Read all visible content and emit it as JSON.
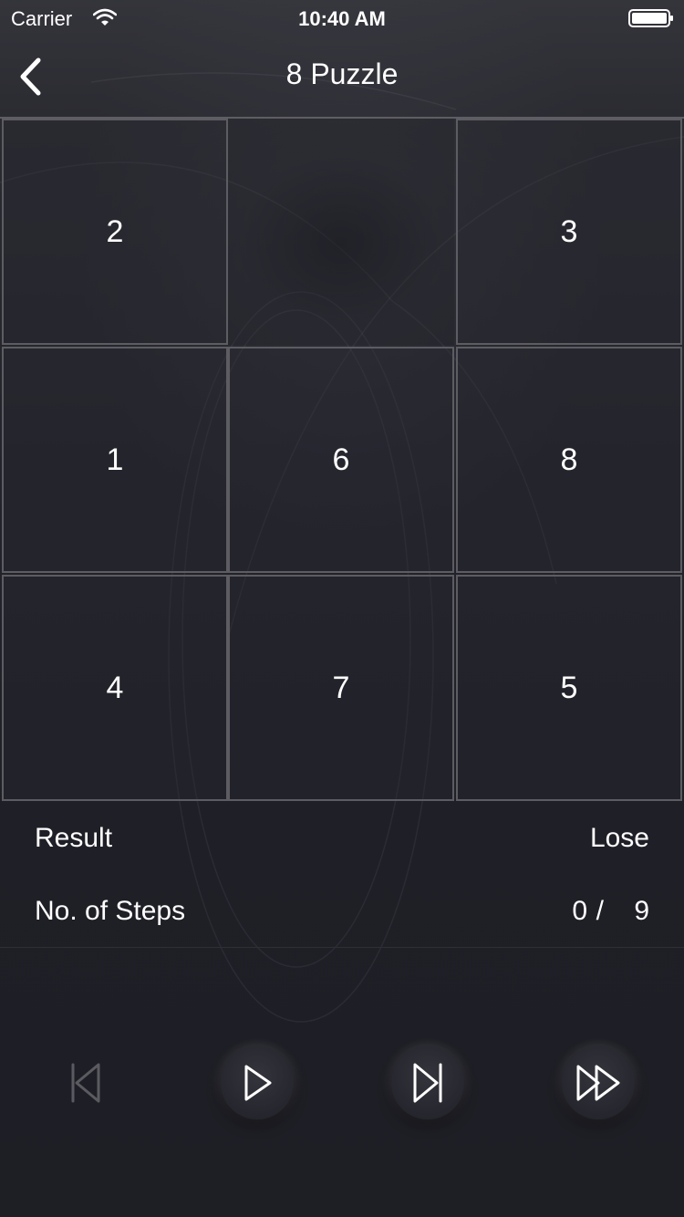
{
  "status_bar": {
    "carrier": "Carrier",
    "time": "10:40 AM",
    "icons": [
      "wifi-icon",
      "battery-icon"
    ]
  },
  "nav": {
    "title": "8 Puzzle",
    "back_icon": "chevron-left-icon"
  },
  "board": {
    "tiles": [
      "2",
      "",
      "3",
      "1",
      "6",
      "8",
      "4",
      "7",
      "5"
    ]
  },
  "result": {
    "label": "Result",
    "value": "Lose"
  },
  "steps": {
    "label": "No. of Steps",
    "current": "0",
    "separator": "/",
    "total": "9"
  },
  "controls": {
    "icons": [
      "skip-to-start-icon",
      "play-icon",
      "step-forward-icon",
      "fast-forward-icon"
    ],
    "first_enabled": false
  },
  "colors": {
    "background": "#1f1f26",
    "tile_border": "#5c5c62",
    "text": "#ffffff",
    "disabled_icon": "#5a5a60"
  }
}
